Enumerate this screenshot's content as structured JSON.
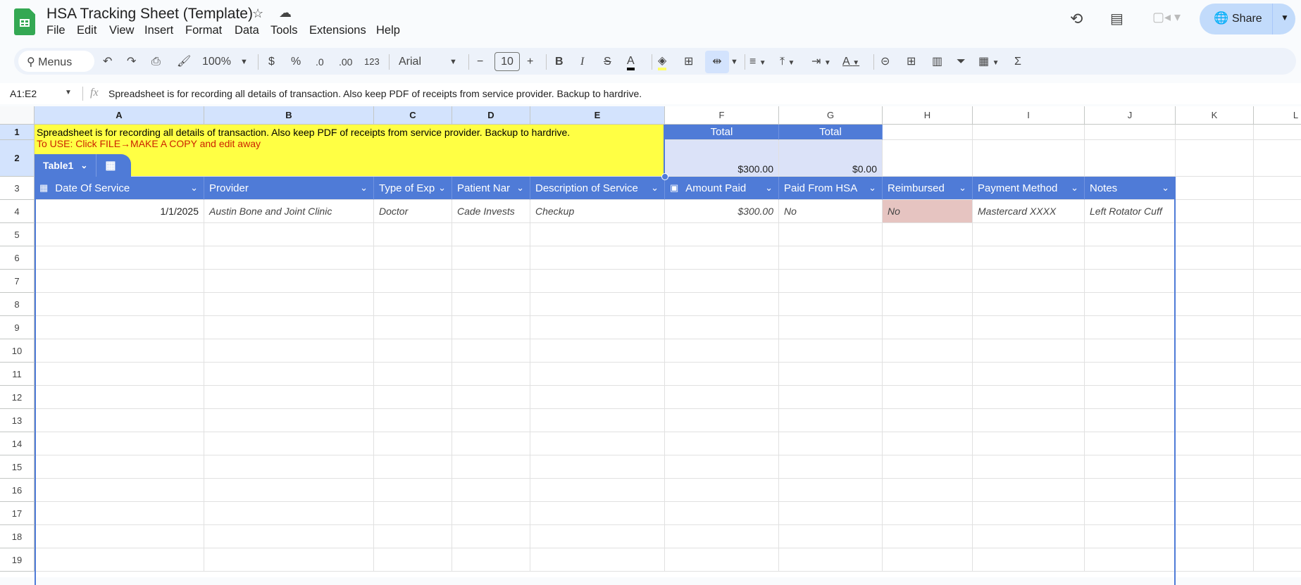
{
  "app": {
    "title": "HSA Tracking Sheet (Template)",
    "share_label": "Share"
  },
  "menu": [
    "File",
    "Edit",
    "View",
    "Insert",
    "Format",
    "Data",
    "Tools",
    "Extensions",
    "Help"
  ],
  "toolbar": {
    "search_label": "Menus",
    "zoom": "100%",
    "currency": "$",
    "percent": "%",
    "dec_decrease": ".0",
    "dec_increase": ".00",
    "format_number": "123",
    "font": "Arial",
    "font_size": "10"
  },
  "formula_bar": {
    "name_box": "A1:E2",
    "fx": "fx",
    "content": "Spreadsheet is for recording all details of transaction. Also keep PDF of receipts from service provider. Backup to hardrive."
  },
  "columns": [
    "A",
    "B",
    "C",
    "D",
    "E",
    "F",
    "G",
    "H",
    "I",
    "J",
    "K",
    "L"
  ],
  "rows": [
    "1",
    "2",
    "3",
    "4",
    "5",
    "6",
    "7",
    "8",
    "9",
    "10",
    "11",
    "12",
    "13",
    "14",
    "15",
    "16",
    "17",
    "18",
    "19"
  ],
  "notes": {
    "line1": "Spreadsheet is for recording all details of transaction. Also keep PDF of receipts from service provider. Backup to hardrive.",
    "line2": "To USE: Click FILE→MAKE A COPY and edit away"
  },
  "totals": {
    "f_label": "Total",
    "g_label": "Total",
    "f_value": "$300.00",
    "g_value": "$0.00"
  },
  "table": {
    "name": "Table1",
    "headers": [
      "Date Of Service",
      "Provider",
      "Type of Exp",
      "Patient Nar",
      "Description of Service",
      "Amount Paid",
      "Paid From HSA",
      "Reimbursed",
      "Payment Method",
      "Notes"
    ],
    "rows": [
      [
        "1/1/2025",
        "Austin Bone and Joint Clinic",
        "Doctor",
        "Cade Invests",
        "Checkup",
        "$300.00",
        "No",
        "No",
        "Mastercard XXXX",
        "Left Rotator Cuff"
      ]
    ]
  },
  "colors": {
    "table_header": "#4f7bd7",
    "note_bg": "#ffff44",
    "note_red": "#cc2200",
    "reimbursed_no": "#e6c4c1"
  }
}
